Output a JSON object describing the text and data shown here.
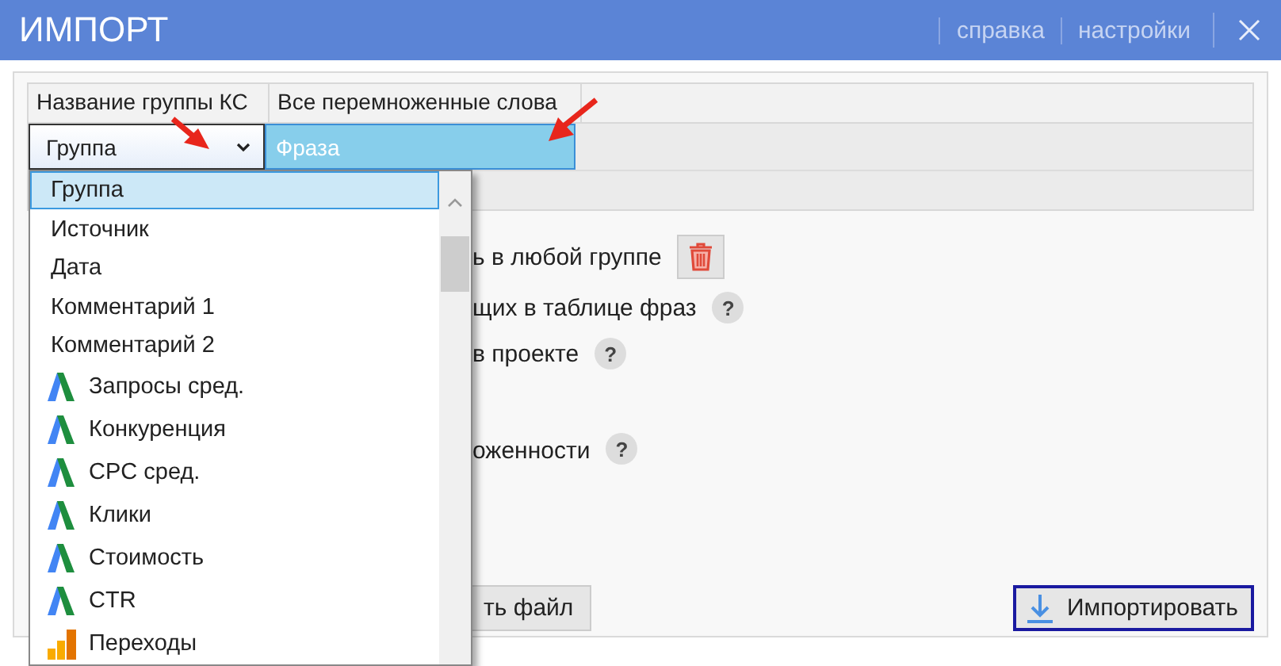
{
  "window": {
    "title": "ИМПОРТ",
    "links": [
      "справка",
      "настройки"
    ]
  },
  "table": {
    "columns": [
      "Название группы КС",
      "Все перемноженные слова"
    ],
    "combo_value": "Группа",
    "cell": "Фраза"
  },
  "options": [
    {
      "text": "ь в любой группе",
      "kind": "delete"
    },
    {
      "text": "щих в таблице фраз",
      "kind": "help",
      "badge": "?"
    },
    {
      "text": "в проекте",
      "kind": "help",
      "badge": "?"
    },
    {
      "text": "оженности",
      "kind": "help",
      "badge": "?"
    }
  ],
  "buttons": [
    {
      "label": "ть файл",
      "kind": "plain"
    },
    {
      "label": "Импортировать",
      "kind": "import"
    }
  ],
  "dropdown": {
    "items": [
      {
        "label": "Группа",
        "kind": "plain",
        "selected": true
      },
      {
        "label": "Источник",
        "kind": "plain",
        "selected": false
      },
      {
        "label": "Дата",
        "kind": "plain",
        "selected": false
      },
      {
        "label": "Комментарий 1",
        "kind": "plain",
        "selected": false
      },
      {
        "label": "Комментарий 2",
        "kind": "plain",
        "selected": false
      },
      {
        "label": "Запросы сред.",
        "kind": "ads",
        "selected": false
      },
      {
        "label": "Конкуренция",
        "kind": "ads",
        "selected": false
      },
      {
        "label": "CPC сред.",
        "kind": "ads",
        "selected": false
      },
      {
        "label": "Клики",
        "kind": "ads",
        "selected": false
      },
      {
        "label": "Стоимость",
        "kind": "ads",
        "selected": false
      },
      {
        "label": "CTR",
        "kind": "ads",
        "selected": false
      },
      {
        "label": "Переходы",
        "kind": "analytics",
        "selected": false
      }
    ]
  }
}
